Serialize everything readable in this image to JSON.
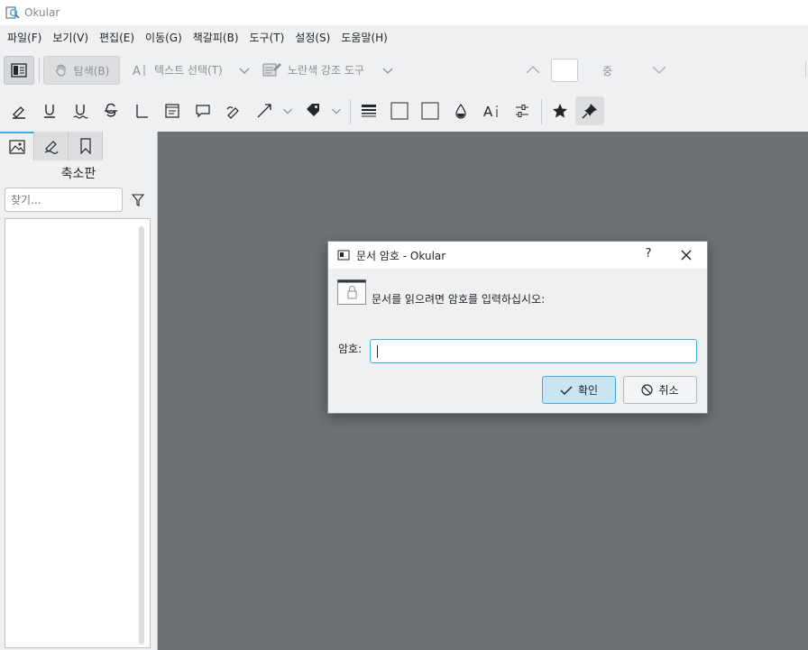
{
  "window": {
    "title": "Okular",
    "icon": "okular-app-icon"
  },
  "menu": [
    "파일(F)",
    "보기(V)",
    "편집(E)",
    "이동(G)",
    "책갈피(B)",
    "도구(T)",
    "설정(S)",
    "도움말(H)"
  ],
  "toolbar": {
    "browse_label": "탐색(B)",
    "text_select_label": "텍스트 선택(T)",
    "highlight_tool_label": "노란색 강조 도구",
    "zoom_label": "중"
  },
  "annotation_tools": [
    "highlighter-icon",
    "underline-icon",
    "squiggle-icon",
    "strikeout-icon",
    "typewriter-icon",
    "inline-note-icon",
    "popup-note-icon",
    "freehand-line-icon",
    "arrow-icon",
    "stamp-icon",
    "line-width-icon",
    "border-color-icon",
    "fill-color-icon",
    "opacity-icon",
    "font-icon",
    "settings-icon",
    "star-icon",
    "pin-icon"
  ],
  "sidebar": {
    "tabs": [
      "thumbnails-icon",
      "annotations-icon",
      "bookmarks-icon"
    ],
    "title": "축소판",
    "search_placeholder": "찾기..."
  },
  "dialog": {
    "title": "문서 암호 - Okular",
    "help": "?",
    "prompt": "문서를 읽으려면 암호를 입력하십시오:",
    "password_label": "암호:",
    "password_value": "",
    "ok_label": "확인",
    "cancel_label": "취소"
  },
  "colors": {
    "accent": "#3daee9",
    "workarea": "#6d7176",
    "window_bg": "#eff0f1"
  }
}
